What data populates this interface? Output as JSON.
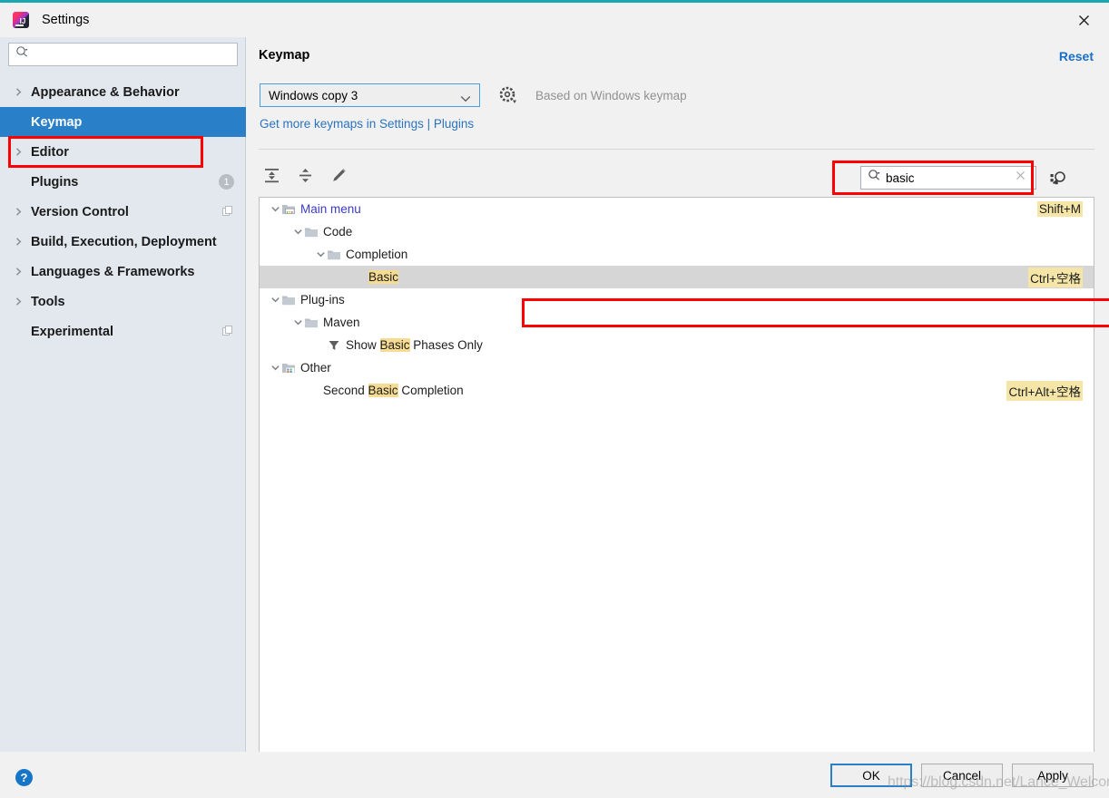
{
  "window": {
    "title": "Settings",
    "close_icon": "close-icon",
    "logo_icon": "intellij-idea-logo",
    "accent_color": "#1aa8ae"
  },
  "sidebar": {
    "search_placeholder": "",
    "search_value": "",
    "search_icon": "search-icon",
    "items": [
      {
        "label": "Appearance & Behavior",
        "expandable": true,
        "selected": false,
        "badge": null
      },
      {
        "label": "Keymap",
        "expandable": false,
        "selected": true,
        "badge": null
      },
      {
        "label": "Editor",
        "expandable": true,
        "selected": false,
        "badge": null
      },
      {
        "label": "Plugins",
        "expandable": false,
        "selected": false,
        "badge": "1"
      },
      {
        "label": "Version Control",
        "expandable": true,
        "selected": false,
        "badge": "copy"
      },
      {
        "label": "Build, Execution, Deployment",
        "expandable": true,
        "selected": false,
        "badge": null
      },
      {
        "label": "Languages & Frameworks",
        "expandable": true,
        "selected": false,
        "badge": null
      },
      {
        "label": "Tools",
        "expandable": true,
        "selected": false,
        "badge": null
      },
      {
        "label": "Experimental",
        "expandable": false,
        "selected": false,
        "badge": "copy"
      }
    ],
    "help_label": "?"
  },
  "main": {
    "title": "Keymap",
    "reset_label": "Reset",
    "keymap_select": {
      "value": "Windows copy 3",
      "options": [
        "Windows copy 3"
      ]
    },
    "gear_icon": "gear-icon",
    "based_on": "Based on Windows keymap",
    "plugins_link": "Get more keymaps in Settings | Plugins",
    "toolbar": {
      "expand_all_icon": "expand-all-icon",
      "collapse_all_icon": "collapse-all-icon",
      "edit_icon": "pencil-edit-icon"
    },
    "search": {
      "value": "basic",
      "placeholder": "",
      "search_icon": "search-icon",
      "clear_icon": "clear-x-icon",
      "shortcut_search_icon": "find-by-shortcut-icon"
    },
    "highlight_term": "Basic"
  },
  "tree": [
    {
      "id": "main-menu",
      "indent": 0,
      "twisty": "down",
      "icon": "folder-menu-icon",
      "text": "Main menu",
      "link": true,
      "selected": false,
      "shortcut": "Shift+M",
      "highlight": null
    },
    {
      "id": "code",
      "indent": 1,
      "twisty": "down",
      "icon": "folder-icon",
      "text": "Code",
      "link": false,
      "selected": false,
      "shortcut": "",
      "highlight": null
    },
    {
      "id": "completion",
      "indent": 2,
      "twisty": "down",
      "icon": "folder-icon",
      "text": "Completion",
      "link": false,
      "selected": false,
      "shortcut": "",
      "highlight": null
    },
    {
      "id": "basic",
      "indent": 3,
      "twisty": "none",
      "icon": "none",
      "text": "Basic",
      "link": false,
      "selected": true,
      "shortcut": "Ctrl+空格",
      "highlight": "Basic"
    },
    {
      "id": "plug-ins",
      "indent": 0,
      "twisty": "down",
      "icon": "folder-icon",
      "text": "Plug-ins",
      "link": false,
      "selected": false,
      "shortcut": "",
      "highlight": null
    },
    {
      "id": "maven",
      "indent": 1,
      "twisty": "down",
      "icon": "folder-icon",
      "text": "Maven",
      "link": false,
      "selected": false,
      "shortcut": "",
      "highlight": null
    },
    {
      "id": "show-basic",
      "indent": 2,
      "twisty": "none",
      "icon": "filter-icon",
      "text": "Show Basic Phases Only",
      "link": false,
      "selected": false,
      "shortcut": "",
      "highlight": "Basic"
    },
    {
      "id": "other",
      "indent": 0,
      "twisty": "down",
      "icon": "folder-other-icon",
      "text": "Other",
      "link": false,
      "selected": false,
      "shortcut": "",
      "highlight": null
    },
    {
      "id": "second-basic",
      "indent": 1,
      "twisty": "none",
      "icon": "none",
      "text": "Second Basic Completion",
      "link": false,
      "selected": false,
      "shortcut": "Ctrl+Alt+空格",
      "highlight": "Basic"
    }
  ],
  "footer": {
    "ok": "OK",
    "cancel": "Cancel",
    "apply": "Apply"
  },
  "watermark": "https://blog.csdn.net/Lance_Welcome"
}
